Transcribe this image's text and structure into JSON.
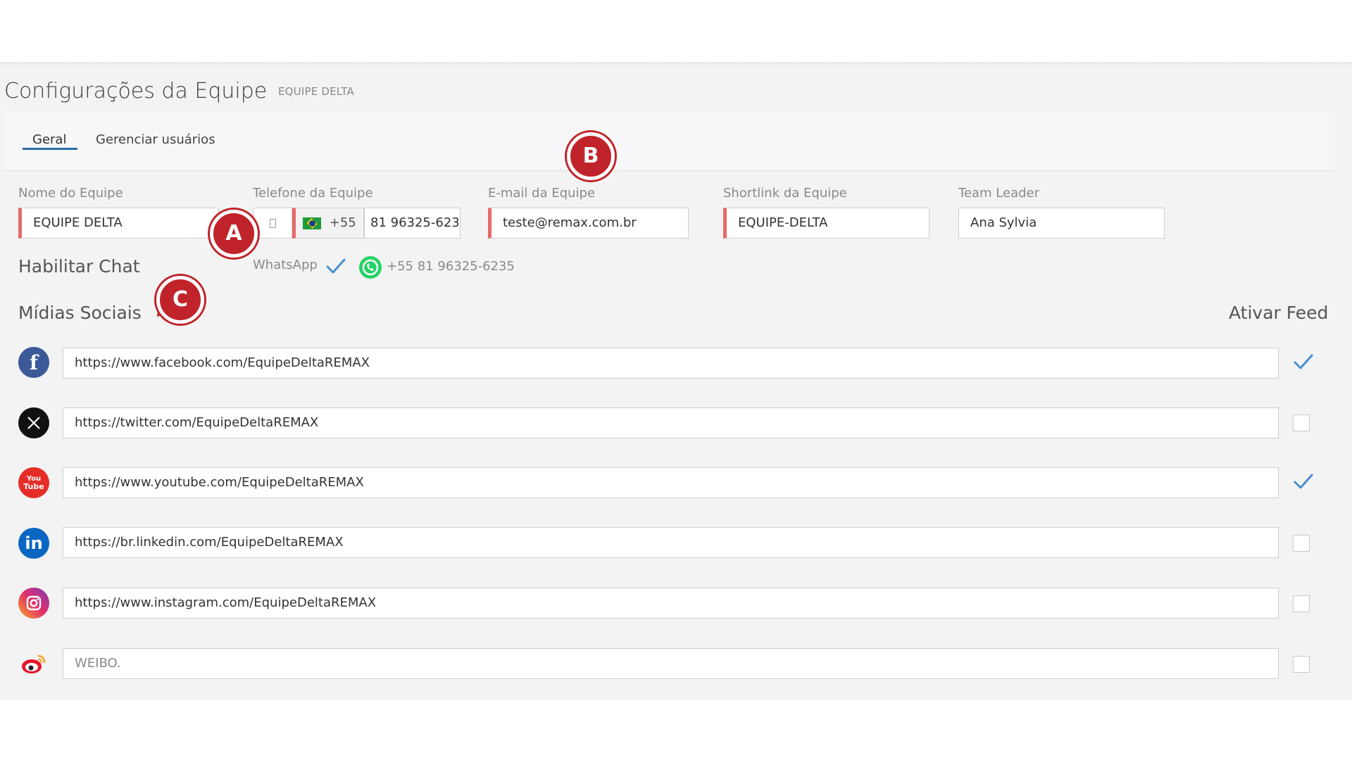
{
  "header": {
    "title": "Configurações da Equipe",
    "subtitle": "EQUIPE DELTA"
  },
  "tabs": [
    {
      "label": "Geral",
      "active": true
    },
    {
      "label": "Gerenciar usuários",
      "active": false
    }
  ],
  "annotations": [
    "A",
    "B",
    "C"
  ],
  "fields": {
    "team_name": {
      "label": "Nome do Equipe",
      "value": "EQUIPE DELTA"
    },
    "team_phone": {
      "label": "Telefone da Equipe",
      "country_code": "+55",
      "value": "81 96325-623"
    },
    "team_email": {
      "label": "E-mail da Equipe",
      "value": "teste@remax.com.br"
    },
    "team_shortlink": {
      "label": "Shortlink da Equipe",
      "value": "EQUIPE-DELTA"
    },
    "team_leader": {
      "label": "Team Leader",
      "value": "Ana Sylvia"
    }
  },
  "chat": {
    "label": "Habilitar Chat",
    "whatsapp_label": "WhatsApp",
    "whatsapp_number": "+55 81 96325-6235"
  },
  "social": {
    "title": "Mídias Sociais",
    "feed_label": "Ativar Feed",
    "items": [
      {
        "network": "facebook",
        "icon": "facebook-icon",
        "value": "https://www.facebook.com/EquipeDeltaREMAX",
        "feed": true,
        "color": "#3b5998"
      },
      {
        "network": "twitter",
        "icon": "x-twitter-icon",
        "value": "https://twitter.com/EquipeDeltaREMAX",
        "feed": false,
        "color": "#111111"
      },
      {
        "network": "youtube",
        "icon": "youtube-icon",
        "value": "https://www.youtube.com/EquipeDeltaREMAX",
        "feed": true,
        "color": "#e52d27"
      },
      {
        "network": "linkedin",
        "icon": "linkedin-icon",
        "value": "https://br.linkedin.com/EquipeDeltaREMAX",
        "feed": false,
        "color": "#0a66c2"
      },
      {
        "network": "instagram",
        "icon": "instagram-icon",
        "value": "https://www.instagram.com/EquipeDeltaREMAX",
        "feed": false,
        "color": "#e1306c"
      },
      {
        "network": "weibo",
        "icon": "weibo-icon",
        "placeholder": "WEIBO.",
        "feed": false,
        "color": "#e6162d"
      }
    ]
  },
  "colors": {
    "accent": "#2a6ea8",
    "required": "#e86a6a",
    "badge": "#c0242a",
    "check": "#4a8fd0",
    "whatsapp": "#25d366"
  }
}
